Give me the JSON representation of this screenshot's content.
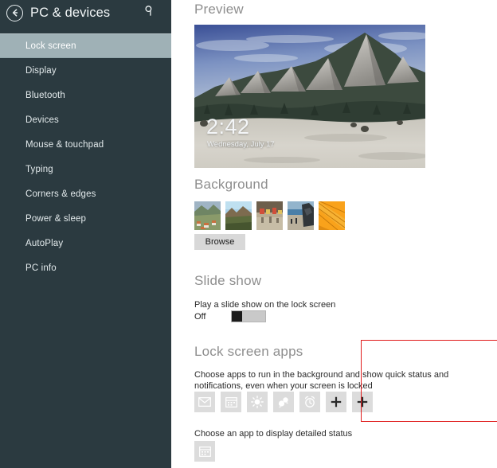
{
  "header": {
    "title": "PC & devices",
    "back_icon": "back-arrow-circle-icon",
    "search_icon": "search-icon"
  },
  "sidebar": {
    "background_color": "#2b3a40",
    "selected_color": "#9fb1b6",
    "items": [
      {
        "label": "Lock screen",
        "selected": true
      },
      {
        "label": "Display",
        "selected": false
      },
      {
        "label": "Bluetooth",
        "selected": false
      },
      {
        "label": "Devices",
        "selected": false
      },
      {
        "label": "Mouse & touchpad",
        "selected": false
      },
      {
        "label": "Typing",
        "selected": false
      },
      {
        "label": "Corners & edges",
        "selected": false
      },
      {
        "label": "Power & sleep",
        "selected": false
      },
      {
        "label": "AutoPlay",
        "selected": false
      },
      {
        "label": "PC info",
        "selected": false
      }
    ]
  },
  "preview": {
    "title": "Preview",
    "lock_time": "2:42",
    "lock_date": "Wednesday, July 17",
    "image_description": "Flatirons mountain range with snow-covered field"
  },
  "background": {
    "title": "Background",
    "browse_label": "Browse",
    "thumbnails": [
      {
        "name": "mountain-village-thumbnail",
        "selected": false
      },
      {
        "name": "mountain-landscape-thumbnail",
        "selected": false
      },
      {
        "name": "market-street-thumbnail",
        "selected": false
      },
      {
        "name": "coastal-beach-thumbnail",
        "selected": false
      },
      {
        "name": "orange-abstract-thumbnail",
        "selected": false
      }
    ]
  },
  "slide_show": {
    "title": "Slide show",
    "description": "Play a slide show on the lock screen",
    "toggle_state": "Off"
  },
  "lock_screen_apps": {
    "title": "Lock screen apps",
    "description": "Choose apps to run in the background and show quick status and notifications, even when your screen is locked",
    "highlight_color": "#e01b1b",
    "apps": [
      {
        "icon": "mail-icon",
        "label": "Mail"
      },
      {
        "icon": "calendar-icon",
        "label": "Calendar"
      },
      {
        "icon": "weather-icon",
        "label": "Weather"
      },
      {
        "icon": "messaging-icon",
        "label": "Messaging"
      },
      {
        "icon": "alarm-icon",
        "label": "Alarms"
      },
      {
        "icon": "plus-icon",
        "label": "+"
      },
      {
        "icon": "plus-icon",
        "label": "+"
      }
    ]
  },
  "detailed_status": {
    "description": "Choose an app to display detailed status",
    "app": {
      "icon": "calendar-icon",
      "label": "Calendar"
    }
  }
}
